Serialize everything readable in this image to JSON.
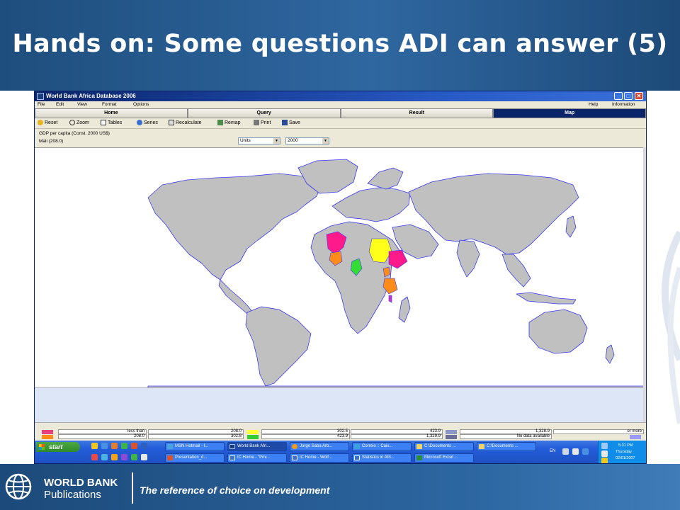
{
  "slide": {
    "title": "Hands on: Some questions ADI can answer (5)"
  },
  "window": {
    "title": "World Bank Africa Database 2006",
    "controls": [
      "_",
      "□",
      "✕"
    ]
  },
  "menubar": {
    "left": [
      "File",
      "Edit",
      "View",
      "Format",
      "Options"
    ],
    "right": [
      "Help",
      "Information"
    ]
  },
  "tabs": [
    {
      "label": "Home",
      "active": false
    },
    {
      "label": "Query",
      "active": false
    },
    {
      "label": "Result",
      "active": false
    },
    {
      "label": "Map",
      "active": true
    }
  ],
  "toolbar": {
    "items": [
      {
        "label": "Reset",
        "icon": "reset-icon"
      },
      {
        "label": "Zoom",
        "icon": "zoom-icon"
      },
      {
        "label": "Tables",
        "icon": "tables-icon"
      },
      {
        "label": "Series",
        "icon": "series-icon"
      },
      {
        "label": "Recalculate",
        "icon": "recalculate-icon"
      },
      {
        "label": "Remap",
        "icon": "remap-icon"
      },
      {
        "label": "Print",
        "icon": "print-icon"
      },
      {
        "label": "Save",
        "icon": "save-icon"
      }
    ]
  },
  "info": {
    "indicator": "GDP per capita (Const. 2000 US$)",
    "country": "Mali (208.0)",
    "units_select": "Units",
    "year_select": "2000"
  },
  "map": {
    "land_color": "#c0c0c0",
    "border_color": "#3a3af0",
    "highlights": [
      {
        "region": "Mali",
        "color": "#ff1a8c"
      },
      {
        "region": "Burkina Faso",
        "color": "#ff8c1a"
      },
      {
        "region": "Cameroon",
        "color": "#33dd33"
      },
      {
        "region": "Sudan",
        "color": "#ffff1a"
      },
      {
        "region": "Ethiopia",
        "color": "#ff1a8c"
      },
      {
        "region": "Uganda",
        "color": "#ff8c1a"
      },
      {
        "region": "Tanzania",
        "color": "#ff8c1a"
      },
      {
        "region": "Malawi",
        "color": "#cc33cc"
      }
    ]
  },
  "legend": {
    "row1": [
      "less than",
      "208.0",
      "302.5",
      "423.9",
      "1,328.9",
      "or more"
    ],
    "row2": [
      "208.0",
      "302.5",
      "423.9",
      "1,329.9",
      "No data available"
    ],
    "swatches": [
      "#e8407a",
      "#ff8c1a",
      "#ffff33",
      "#33cc33",
      "#8c96c8",
      "#6d6d9c",
      "#9999ff"
    ]
  },
  "taskbar": {
    "start": "start",
    "row1": [
      {
        "label": "MSN Hotmail - I...",
        "color": "#4aa3df"
      },
      {
        "label": "World Bank Afri...",
        "color": "#1b3d7a",
        "active": true
      },
      {
        "label": "Jorge Saba Arb...",
        "color": "#f29b1a"
      },
      {
        "label": "Correio :: Caix...",
        "color": "#3aa0e0"
      },
      {
        "label": "C:\\Documents ...",
        "color": "#f2d36b"
      },
      {
        "label": "C:\\Documents ...",
        "color": "#f2d36b"
      }
    ],
    "row2": [
      {
        "label": "Presentation_d...",
        "color": "#d9532c"
      },
      {
        "label": "IC Home - \"Priv...",
        "color": "#3a70d0"
      },
      {
        "label": "IC Home - Wolf...",
        "color": "#3a70d0"
      },
      {
        "label": "Statistics in Afri...",
        "color": "#3a70d0"
      },
      {
        "label": "Microsoft Excel ...",
        "color": "#2e8b3a"
      }
    ],
    "language": "EN",
    "clock": {
      "time": "5:31 PM",
      "day": "Thursday",
      "date": "02/01/2007"
    }
  },
  "footer": {
    "brand_line1": "WORLD BANK",
    "brand_line2": "Publications",
    "tagline": "The reference of choice on development"
  }
}
